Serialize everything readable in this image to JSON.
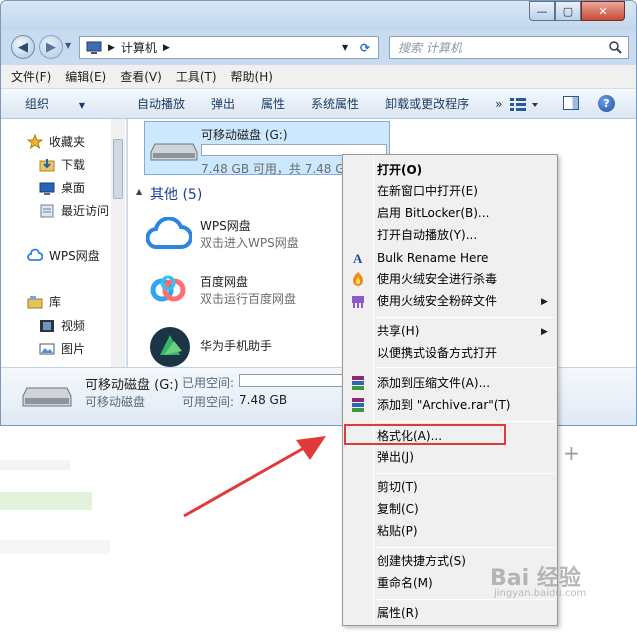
{
  "window": {
    "caption_minimize": "—",
    "caption_maximize": "▢",
    "caption_close": "✕"
  },
  "address": {
    "path": "计算机",
    "search_placeholder": "搜索 计算机"
  },
  "menubar": [
    "文件(F)",
    "编辑(E)",
    "查看(V)",
    "工具(T)",
    "帮助(H)"
  ],
  "toolbar": {
    "organize": "组织",
    "autoplay": "自动播放",
    "eject": "弹出",
    "properties": "属性",
    "system_properties": "系统属性",
    "uninstall": "卸载或更改程序",
    "more": "»"
  },
  "nav": {
    "favorites": "收藏夹",
    "downloads": "下载",
    "desktop": "桌面",
    "recent": "最近访问",
    "wps": "WPS网盘",
    "libraries": "库",
    "videos": "视频",
    "pictures": "图片"
  },
  "content": {
    "drive_name": "可移动磁盘 (G:)",
    "drive_space": "7.48 GB 可用，共 7.48 GB",
    "other_group": "其他 (5)",
    "items": [
      {
        "name": "WPS网盘",
        "sub": "双击进入WPS网盘"
      },
      {
        "name": "百度网盘",
        "sub": "双击运行百度网盘"
      },
      {
        "name": "华为手机助手",
        "sub": ""
      }
    ]
  },
  "details": {
    "name": "可移动磁盘 (G:)",
    "used_label": "已用空间:",
    "type": "可移动磁盘",
    "free_label": "可用空间:",
    "free_value": "7.48 GB"
  },
  "context_menu": {
    "open": "打开(O)",
    "open_new_window": "在新窗口中打开(E)",
    "bitlocker": "启用 BitLocker(B)...",
    "autoplay": "打开自动播放(Y)...",
    "bulk_rename": "Bulk Rename Here",
    "huorong_scan": "使用火绒安全进行杀毒",
    "huorong_shred": "使用火绒安全粉碎文件",
    "share": "共享(H)",
    "portable": "以便携式设备方式打开",
    "add_archive": "添加到压缩文件(A)...",
    "add_rar": "添加到 \"Archive.rar\"(T)",
    "format": "格式化(A)...",
    "eject": "弹出(J)",
    "cut": "剪切(T)",
    "copy": "复制(C)",
    "paste": "粘贴(P)",
    "shortcut": "创建快捷方式(S)",
    "rename": "重命名(M)",
    "properties": "属性(R)"
  },
  "watermark": {
    "brand": "Bai 经验",
    "url": "jingyan.baidu.com"
  },
  "colors": {
    "highlight_box": "#e2393a",
    "arrow": "#e2393a",
    "accent_blue": "#1e3c64"
  }
}
